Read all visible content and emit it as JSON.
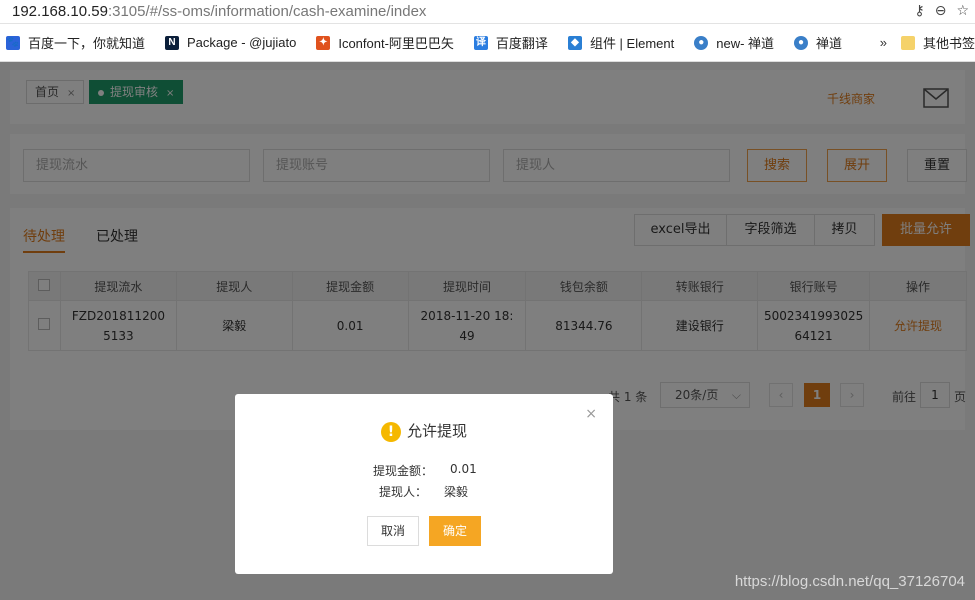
{
  "browser": {
    "url_host": "192.168.10.59",
    "url_rest": ":3105/#/ss-oms/information/cash-examine/index",
    "bookmarks": [
      {
        "label": "百度一下，你就知道",
        "color": "#2b63d9"
      },
      {
        "label": "Package - @jujiato",
        "color": "#0b1f3a"
      },
      {
        "label": "Iconfont-阿里巴巴矢",
        "color": "#e0521e"
      },
      {
        "label": "百度翻译",
        "color": "#2b7de0"
      },
      {
        "label": "组件 | Element",
        "color": "#2a7fd4"
      },
      {
        "label": "new- 禅道",
        "color": "#3a7fc8"
      },
      {
        "label": "禅道",
        "color": "#3a7fc8"
      }
    ],
    "more": "»",
    "other_bookmarks": "其他书签"
  },
  "tabs": [
    {
      "label": "首页",
      "close": "×"
    },
    {
      "label": "提现审核",
      "close": "×"
    }
  ],
  "header": {
    "user_link": "千线商家"
  },
  "search": {
    "flow_placeholder": "提现流水",
    "account_placeholder": "提现账号",
    "person_placeholder": "提现人",
    "search_btn": "搜索",
    "expand_btn": "展开",
    "reset_btn": "重置"
  },
  "list": {
    "tab_pending": "待处理",
    "tab_done": "已处理",
    "excel_btn": "excel导出",
    "filter_btn": "字段筛选",
    "copy_btn": "拷贝",
    "batch_btn": "批量允许",
    "columns": [
      "提现流水",
      "提现人",
      "提现金额",
      "提现时间",
      "钱包余额",
      "转账银行",
      "银行账号",
      "操作"
    ],
    "rows": [
      {
        "flow": "FZD2018112005133",
        "person": "梁毅",
        "amount": "0.01",
        "time": "2018-11-20 18:49",
        "balance": "81344.76",
        "bank": "建设银行",
        "account": "500234199302564121",
        "action": "允许提现"
      }
    ]
  },
  "pager": {
    "total": "共 1 条",
    "page_size": "20条/页",
    "current": "1",
    "goto_label": "前往",
    "goto_value": "1",
    "page_suffix": "页"
  },
  "dialog": {
    "title": "允许提现",
    "amount_label": "提现金额：",
    "amount_value": "0.01",
    "person_label": "提现人：",
    "person_value": "梁毅",
    "cancel": "取消",
    "ok": "确定",
    "close": "×"
  },
  "watermark": "https://blog.csdn.net/qq_37126704"
}
